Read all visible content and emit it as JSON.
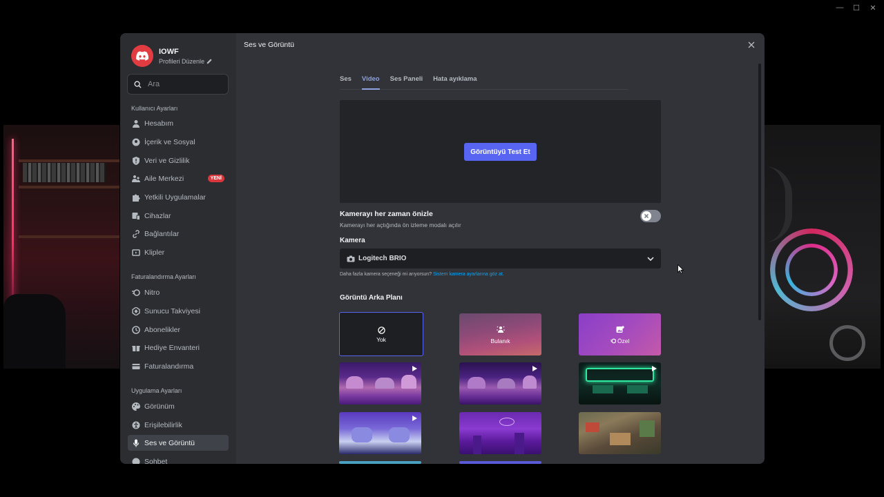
{
  "window_controls": {
    "minimize": "—",
    "maximize": "☐",
    "close": "✕"
  },
  "profile": {
    "name": "IOWF",
    "edit_label": "Profileri Düzenle"
  },
  "search": {
    "placeholder": "Ara"
  },
  "sidebar": {
    "sections": [
      {
        "title": "Kullanıcı Ayarları"
      },
      {
        "title": "Faturalandırma Ayarları"
      },
      {
        "title": "Uygulama Ayarları"
      }
    ],
    "user_items": [
      {
        "label": "Hesabım",
        "icon": "person-icon"
      },
      {
        "label": "İçerik ve Sosyal",
        "icon": "content-social-icon"
      },
      {
        "label": "Veri ve Gizlilik",
        "icon": "shield-icon"
      },
      {
        "label": "Aile Merkezi",
        "icon": "family-icon",
        "badge": "YENİ"
      },
      {
        "label": "Yetkili Uygulamalar",
        "icon": "puzzle-icon"
      },
      {
        "label": "Cihazlar",
        "icon": "devices-icon"
      },
      {
        "label": "Bağlantılar",
        "icon": "link-icon"
      },
      {
        "label": "Klipler",
        "icon": "clips-icon"
      }
    ],
    "billing_items": [
      {
        "label": "Nitro",
        "icon": "nitro-icon"
      },
      {
        "label": "Sunucu Takviyesi",
        "icon": "boost-icon"
      },
      {
        "label": "Abonelikler",
        "icon": "subscriptions-icon"
      },
      {
        "label": "Hediye Envanteri",
        "icon": "gift-icon"
      },
      {
        "label": "Faturalandırma",
        "icon": "billing-icon"
      }
    ],
    "app_items": [
      {
        "label": "Görünüm",
        "icon": "palette-icon"
      },
      {
        "label": "Erişilebilirlik",
        "icon": "accessibility-icon"
      },
      {
        "label": "Ses ve Görüntü",
        "icon": "microphone-icon",
        "active": true
      },
      {
        "label": "Sohbet",
        "icon": "chat-icon"
      }
    ]
  },
  "content": {
    "title": "Ses ve Görüntü",
    "tabs": [
      {
        "label": "Ses"
      },
      {
        "label": "Video",
        "active": true
      },
      {
        "label": "Ses Paneli"
      },
      {
        "label": "Hata ayıklama"
      }
    ],
    "test_button": "Görüntüyü Test Et",
    "always_preview": {
      "title": "Kamerayı her zaman önizle",
      "description": "Kamerayı her açtığında ön izleme modalı açılır",
      "enabled": false
    },
    "camera": {
      "label": "Kamera",
      "selected": "Logitech BRIO",
      "hint": "Daha fazla kamera seçeneği mi arıyorsun?",
      "hint_link": "Sistem kamera ayarlarına göz at."
    },
    "background": {
      "title": "Görüntü Arka Planı",
      "options": [
        {
          "label": "Yok",
          "icon": "none-icon",
          "selected": true
        },
        {
          "label": "Bulanık",
          "icon": "blur-icon"
        },
        {
          "label": "Özel",
          "icon": "image-add-icon"
        }
      ]
    }
  },
  "colors": {
    "accent": "#5865f2",
    "link": "#00a8fc",
    "badge": "#da373c",
    "modal_bg": "#313338",
    "sidebar_bg": "#2b2d31"
  }
}
